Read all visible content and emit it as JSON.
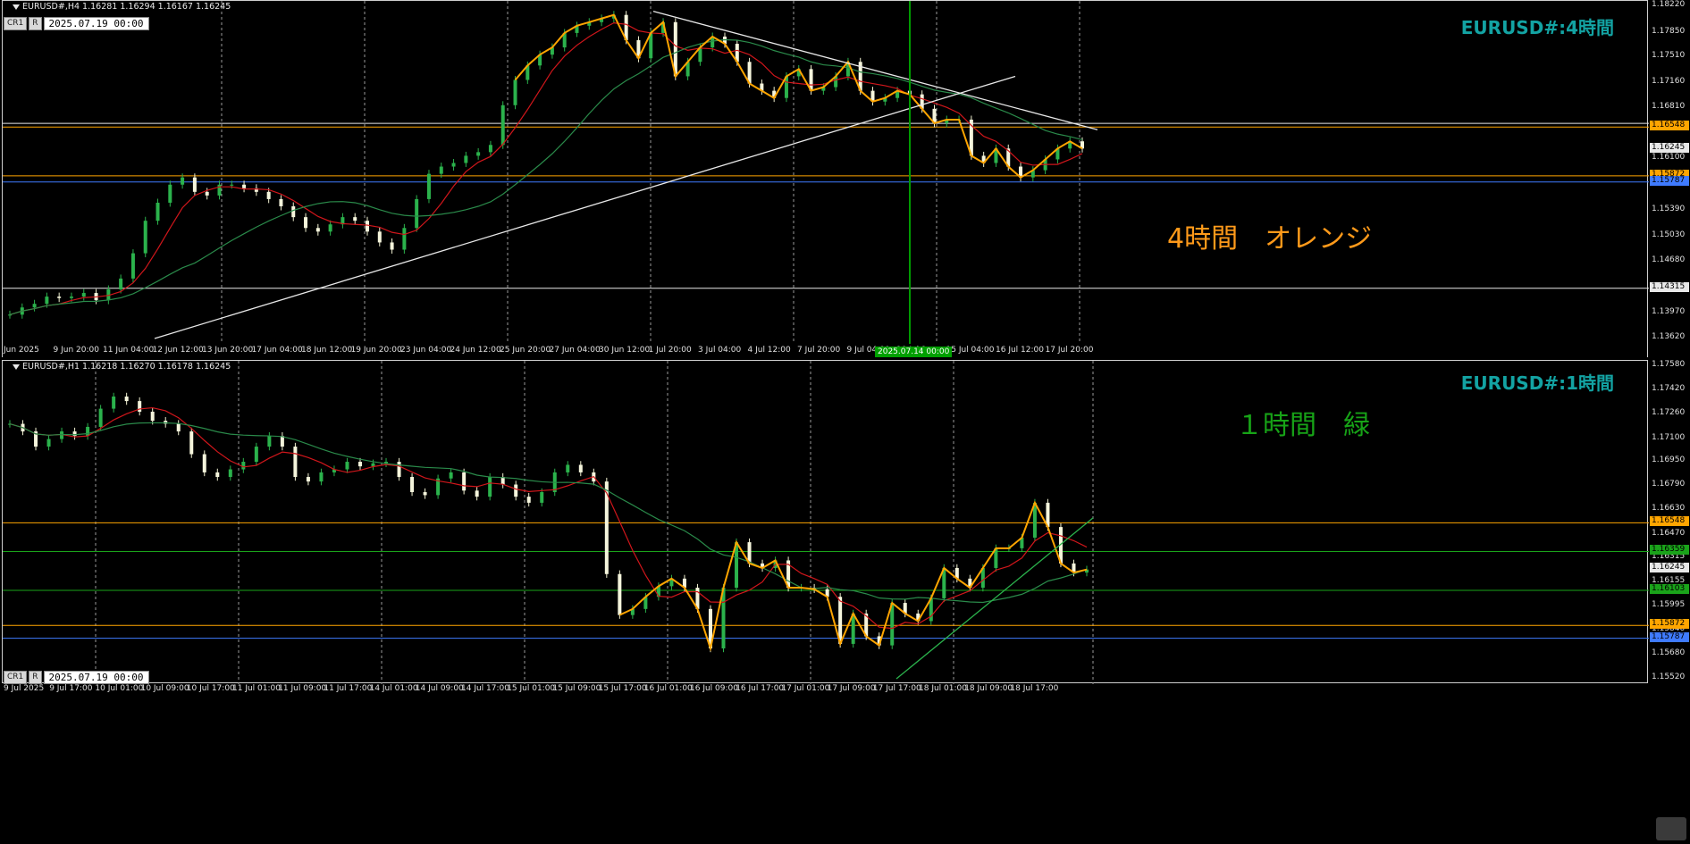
{
  "h4": {
    "header": "EURUSD#,H4  1.16281 1.16294 1.16167 1.16245",
    "toolbar": {
      "cr1": "CR1",
      "r": "R",
      "date": "2025.07.19 00:00"
    },
    "title": "EURUSD#:4時間",
    "annotation": "4時間　オレンジ",
    "annotation_color": "#ff9a1a",
    "price_labels": [
      "1.18220",
      "1.17850",
      "1.17510",
      "1.17160",
      "1.16810",
      "1.16100",
      "1.15390",
      "1.15030",
      "1.14680",
      "1.13970",
      "1.13620"
    ],
    "price_tags": [
      {
        "text": "1.16548",
        "bg": "#ffa500"
      },
      {
        "text": "1.16245",
        "bg": "#e8e8e8"
      },
      {
        "text": "1.15872",
        "bg": "#ffa500"
      },
      {
        "text": "1.15787",
        "bg": "#3f7bff"
      },
      {
        "text": "1.14315",
        "bg": "#e8e8e8"
      }
    ],
    "time_labels": [
      "Jun 2025",
      "9 Jun 20:00",
      "11 Jun 04:00",
      "12 Jun 12:00",
      "13 Jun 20:00",
      "17 Jun 04:00",
      "18 Jun 12:00",
      "19 Jun 20:00",
      "23 Jun 04:00",
      "24 Jun 12:00",
      "25 Jun 20:00",
      "27 Jun 04:00",
      "30 Jun 12:00",
      "1 Jul 20:00",
      "3 Jul 04:00",
      "4 Jul 12:00",
      "7 Jul 20:00",
      "9 Jul 04:00",
      "10 Jul 1",
      "15 Jul 04:00",
      "16 Jul 12:00",
      "17 Jul 20:00"
    ],
    "crosshair_tag": "2025.07.14 00:00",
    "chart_data": {
      "type": "candlestick",
      "symbol": "EURUSD#",
      "timeframe": "H4",
      "ylim": [
        1.1362,
        1.1822
      ],
      "close_path": [
        1.1395,
        1.1405,
        1.141,
        1.142,
        1.1418,
        1.142,
        1.1425,
        1.1415,
        1.143,
        1.1445,
        1.148,
        1.1525,
        1.155,
        1.1575,
        1.1585,
        1.1565,
        1.156,
        1.1575,
        1.1575,
        1.157,
        1.1565,
        1.1555,
        1.1545,
        1.153,
        1.1515,
        1.151,
        1.152,
        1.153,
        1.1525,
        1.151,
        1.1495,
        1.1485,
        1.1515,
        1.1555,
        1.159,
        1.16,
        1.1605,
        1.1615,
        1.162,
        1.163,
        1.1685,
        1.172,
        1.174,
        1.1755,
        1.1765,
        1.1785,
        1.1795,
        1.18,
        1.1805,
        1.181,
        1.1775,
        1.175,
        1.1785,
        1.18,
        1.1725,
        1.1745,
        1.1765,
        1.178,
        1.177,
        1.1745,
        1.1715,
        1.1705,
        1.1695,
        1.1725,
        1.1735,
        1.1705,
        1.171,
        1.1725,
        1.1745,
        1.1705,
        1.169,
        1.1695,
        1.1705,
        1.17,
        1.168,
        1.166,
        1.1665,
        1.1665,
        1.1615,
        1.1605,
        1.1625,
        1.16,
        1.1585,
        1.1595,
        1.161,
        1.1625,
        1.1635,
        1.1625
      ]
    }
  },
  "h1": {
    "header": "EURUSD#,H1  1.16218 1.16270 1.16178 1.16245",
    "toolbar": {
      "cr1": "CR1",
      "r": "R",
      "date": "2025.07.19 00:00"
    },
    "title": "EURUSD#:1時間",
    "annotation": "１時間　緑",
    "annotation_color": "#17a317",
    "price_labels": [
      "1.17580",
      "1.17420",
      "1.17260",
      "1.17100",
      "1.16950",
      "1.16790",
      "1.16630",
      "1.16470",
      "1.16315",
      "1.16155",
      "1.15995",
      "1.15840",
      "1.15680",
      "1.15520"
    ],
    "price_tags": [
      {
        "text": "1.16548",
        "bg": "#ffa500"
      },
      {
        "text": "1.16359",
        "bg": "#1aa31a"
      },
      {
        "text": "1.16245",
        "bg": "#e8e8e8"
      },
      {
        "text": "1.16103",
        "bg": "#1aa31a"
      },
      {
        "text": "1.15872",
        "bg": "#ffa500"
      },
      {
        "text": "1.15787",
        "bg": "#3f7bff"
      }
    ],
    "time_labels": [
      "9 Jul 2025",
      "9 Jul 17:00",
      "10 Jul 01:00",
      "10 Jul 09:00",
      "10 Jul 17:00",
      "11 Jul 01:00",
      "11 Jul 09:00",
      "11 Jul 17:00",
      "14 Jul 01:00",
      "14 Jul 09:00",
      "14 Jul 17:00",
      "15 Jul 01:00",
      "15 Jul 09:00",
      "15 Jul 17:00",
      "16 Jul 01:00",
      "16 Jul 09:00",
      "16 Jul 17:00",
      "17 Jul 01:00",
      "17 Jul 09:00",
      "17 Jul 17:00",
      "18 Jul 01:00",
      "18 Jul 09:00",
      "18 Jul 17:00"
    ],
    "chart_data": {
      "type": "candlestick",
      "symbol": "EURUSD#",
      "timeframe": "H1",
      "ylim": [
        1.1552,
        1.1758
      ],
      "close_path": [
        1.172,
        1.1715,
        1.1705,
        1.171,
        1.1715,
        1.1712,
        1.1718,
        1.173,
        1.1738,
        1.1735,
        1.1728,
        1.1722,
        1.172,
        1.1715,
        1.17,
        1.1688,
        1.1685,
        1.169,
        1.1695,
        1.1705,
        1.1712,
        1.1705,
        1.1685,
        1.1682,
        1.1688,
        1.169,
        1.1695,
        1.1692,
        1.1694,
        1.1695,
        1.1685,
        1.1675,
        1.1673,
        1.1684,
        1.1688,
        1.1676,
        1.1672,
        1.1685,
        1.168,
        1.1672,
        1.1668,
        1.1675,
        1.1688,
        1.1693,
        1.1688,
        1.1682,
        1.1621,
        1.1594,
        1.1598,
        1.1606,
        1.1613,
        1.1618,
        1.1612,
        1.1598,
        1.1572,
        1.1612,
        1.1642,
        1.1628,
        1.1625,
        1.163,
        1.1612,
        1.1612,
        1.1611,
        1.1606,
        1.1575,
        1.1595,
        1.158,
        1.1574,
        1.1602,
        1.1595,
        1.159,
        1.1605,
        1.1625,
        1.1618,
        1.1612,
        1.1625,
        1.1638,
        1.1638,
        1.1645,
        1.1668,
        1.1652,
        1.1628,
        1.1622,
        1.1624
      ]
    }
  }
}
